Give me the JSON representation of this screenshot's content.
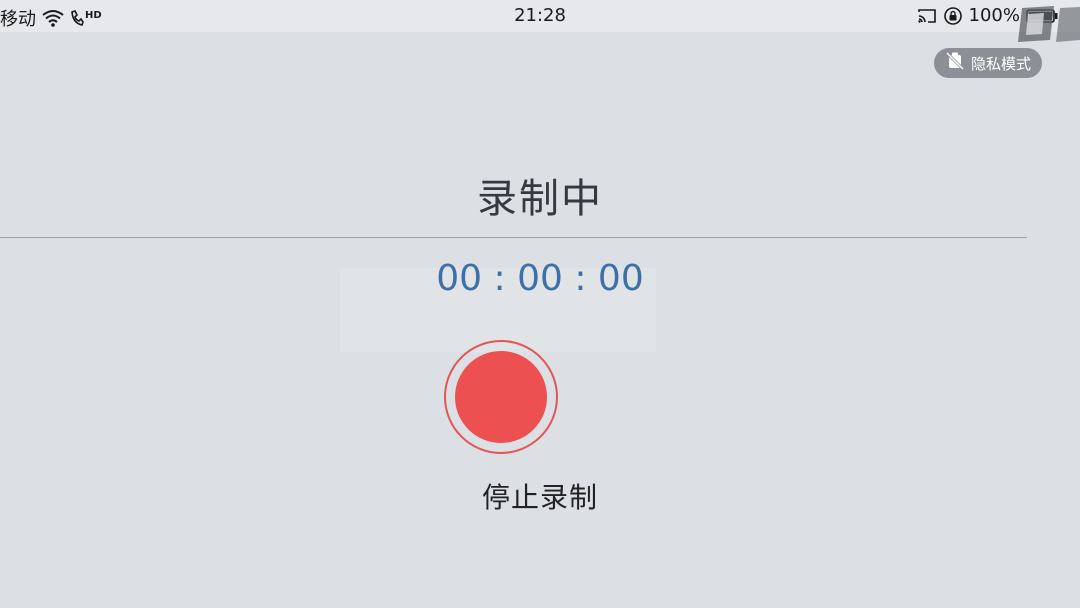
{
  "status_bar": {
    "carrier": "移动",
    "network_badge": "HD",
    "time": "21:28",
    "battery": "100%",
    "icons": [
      "wifi-icon",
      "call-hd-icon",
      "cast-icon",
      "rotation-lock-icon",
      "battery-icon"
    ]
  },
  "privacy_mode": {
    "label": "隐私模式",
    "icon": "camera-off-icon"
  },
  "recording": {
    "title": "录制中",
    "timer": "00 : 00 : 00",
    "stop_label": "停止录制",
    "button_color": "#ec5050"
  },
  "colors": {
    "background": "#dcdfe3",
    "timer": "#3d6fa8",
    "record": "#ec5050"
  }
}
